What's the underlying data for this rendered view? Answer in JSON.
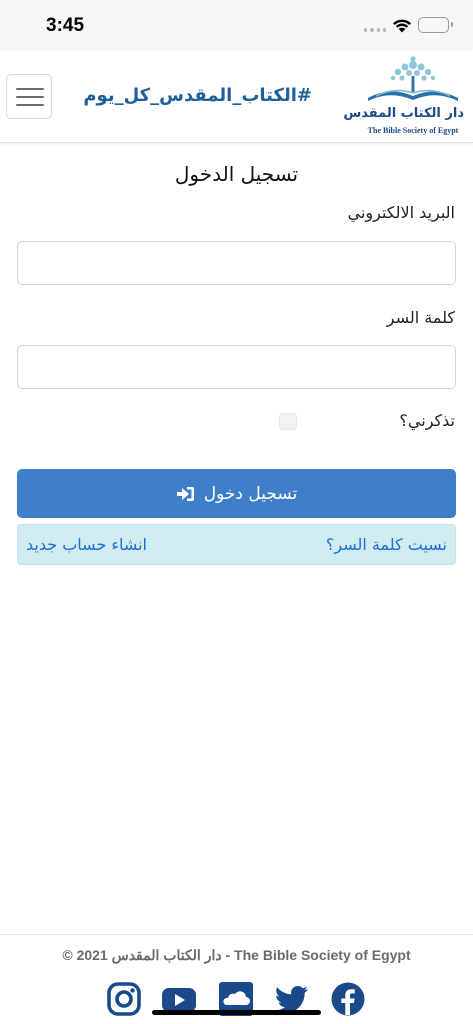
{
  "status_bar": {
    "time": "3:45",
    "icons": [
      "signal-icon",
      "wifi-icon",
      "battery-icon"
    ]
  },
  "header": {
    "hashtag": "#الكتاب_المقدس_كل_يوم",
    "logo_arabic": "دار الكتاب المقدس",
    "logo_english": "The Bible Society of Egypt",
    "menu_icon": "hamburger-menu-icon"
  },
  "form": {
    "title": "تسجيل الدخول",
    "email_label": "البريد الالكتروني",
    "email_value": "",
    "password_label": "كلمة السر",
    "password_value": "",
    "remember_label": "تذكرني؟",
    "remember_checked": false,
    "submit_label": "تسجيل دخول",
    "submit_icon": "sign-in-icon",
    "forgot_password": "نسيت كلمة السر؟",
    "create_account": "انشاء حساب جديد"
  },
  "footer": {
    "copyright": "© 2021 دار الكتاب المقدس - The Bible Society of Egypt",
    "social": [
      "instagram-icon",
      "youtube-icon",
      "soundcloud-icon",
      "twitter-icon",
      "facebook-icon"
    ]
  },
  "colors": {
    "primary": "#3f7fca",
    "brand_blue": "#1f5f9b",
    "alert_bg": "#d1ecf1",
    "link": "#1f6fd1"
  }
}
